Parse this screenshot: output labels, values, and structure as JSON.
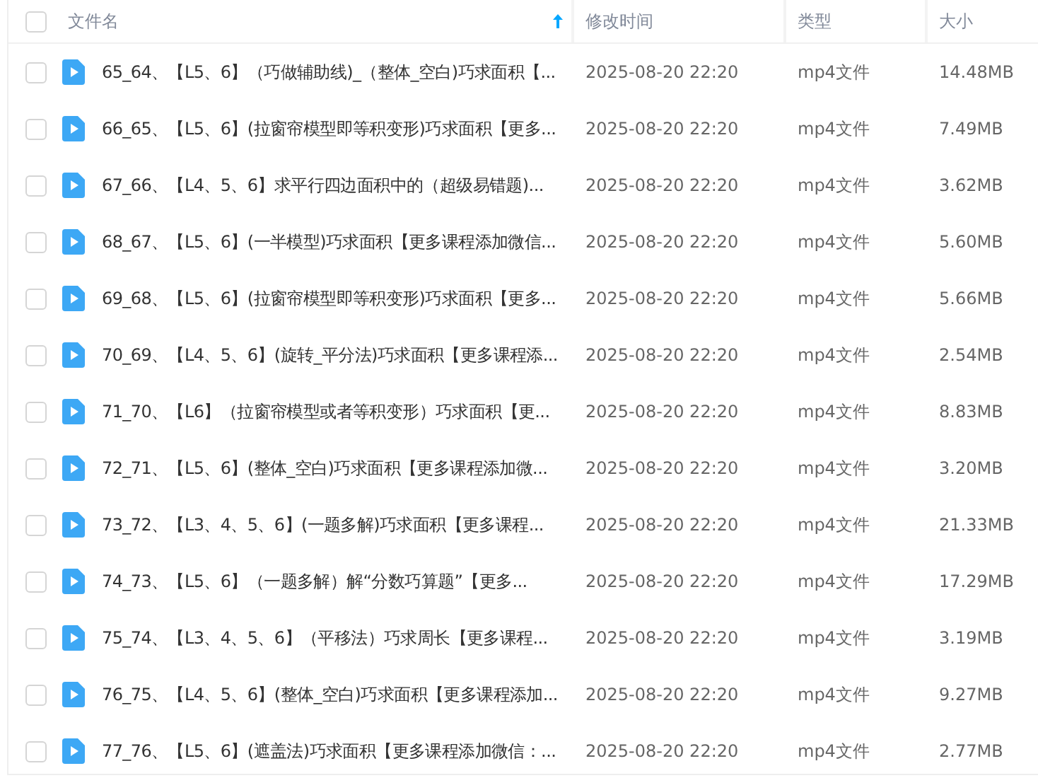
{
  "header": {
    "select_all": {
      "checked": false
    },
    "columns": [
      {
        "label": "文件名",
        "sorted": true
      },
      {
        "label": "修改时间",
        "sorted": false
      },
      {
        "label": "类型",
        "sorted": false
      },
      {
        "label": "大小",
        "sorted": false
      }
    ]
  },
  "rows": [
    {
      "checked": false,
      "name": "65_64、【L5、6】（巧做辅助线)_（整体_空白)巧求面积【...",
      "modified": "2025-08-20 22:20",
      "type": "mp4文件",
      "size": "14.48MB"
    },
    {
      "checked": false,
      "name": "66_65、【L5、6】(拉窗帘模型即等积变形)巧求面积【更多...",
      "modified": "2025-08-20 22:20",
      "type": "mp4文件",
      "size": "7.49MB"
    },
    {
      "checked": false,
      "name": "67_66、【L4、5、6】求平行四边面积中的（超级易错题)...",
      "modified": "2025-08-20 22:20",
      "type": "mp4文件",
      "size": "3.62MB"
    },
    {
      "checked": false,
      "name": "68_67、【L5、6】(一半模型)巧求面积【更多课程添加微信...",
      "modified": "2025-08-20 22:20",
      "type": "mp4文件",
      "size": "5.60MB"
    },
    {
      "checked": false,
      "name": "69_68、【L5、6】(拉窗帘模型即等积变形)巧求面积【更多...",
      "modified": "2025-08-20 22:20",
      "type": "mp4文件",
      "size": "5.66MB"
    },
    {
      "checked": false,
      "name": "70_69、【L4、5、6】(旋转_平分法)巧求面积【更多课程添...",
      "modified": "2025-08-20 22:20",
      "type": "mp4文件",
      "size": "2.54MB"
    },
    {
      "checked": false,
      "name": "71_70、【L6】（拉窗帘模型或者等积变形）巧求面积【更...",
      "modified": "2025-08-20 22:20",
      "type": "mp4文件",
      "size": "8.83MB"
    },
    {
      "checked": false,
      "name": "72_71、【L5、6】(整体_空白)巧求面积【更多课程添加微...",
      "modified": "2025-08-20 22:20",
      "type": "mp4文件",
      "size": "3.20MB"
    },
    {
      "checked": false,
      "name": "73_72、【L3、4、5、6】(一题多解)巧求面积【更多课程...",
      "modified": "2025-08-20 22:20",
      "type": "mp4文件",
      "size": "21.33MB"
    },
    {
      "checked": false,
      "name": "74_73、【L5、6】（一题多解）解“分数巧算题”【更多...",
      "modified": "2025-08-20 22:20",
      "type": "mp4文件",
      "size": "17.29MB"
    },
    {
      "checked": false,
      "name": "75_74、【L3、4、5、6】（平移法）巧求周长【更多课程...",
      "modified": "2025-08-20 22:20",
      "type": "mp4文件",
      "size": "3.19MB"
    },
    {
      "checked": false,
      "name": "76_75、【L4、5、6】(整体_空白)巧求面积【更多课程添加...",
      "modified": "2025-08-20 22:20",
      "type": "mp4文件",
      "size": "9.27MB"
    },
    {
      "checked": false,
      "name": "77_76、【L5、6】(遮盖法)巧求面积【更多课程添加微信：...",
      "modified": "2025-08-20 22:20",
      "type": "mp4文件",
      "size": "2.77MB"
    }
  ]
}
